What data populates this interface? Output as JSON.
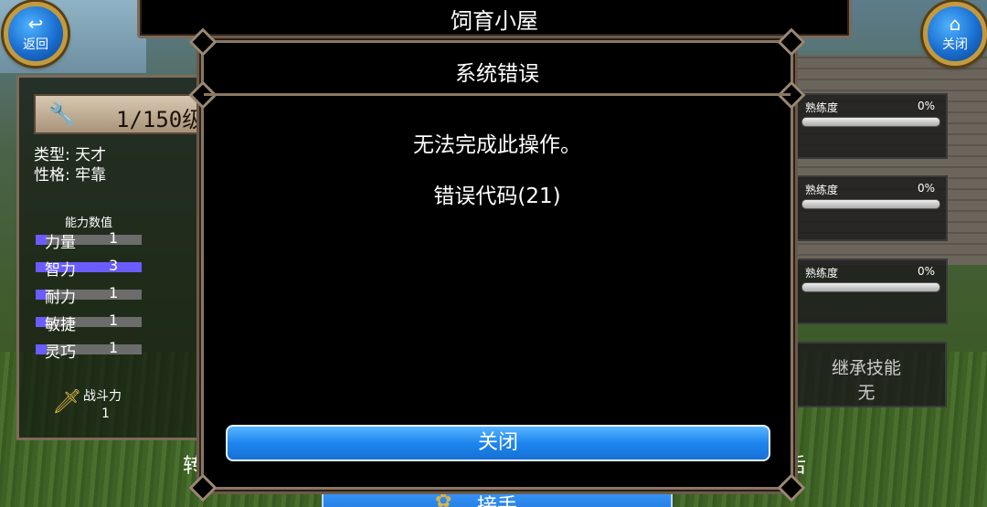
{
  "title_bar": {
    "text": "饲育小屋"
  },
  "buttons": {
    "back": {
      "icon": "back-arrow-icon",
      "label": "返回"
    },
    "close": {
      "icon": "home-icon",
      "label": "关闭"
    }
  },
  "left_panel": {
    "level": "1/150级",
    "type_line": "类型: 天才",
    "personality_line": "性格: 牢靠",
    "stats_title": "能力数值",
    "stats": [
      {
        "name": "力量",
        "value": "1",
        "fill": 0.1
      },
      {
        "name": "智力",
        "value": "3",
        "fill": 1.0
      },
      {
        "name": "耐力",
        "value": "1",
        "fill": 0.1
      },
      {
        "name": "敏捷",
        "value": "1",
        "fill": 0.1
      },
      {
        "name": "灵巧",
        "value": "1",
        "fill": 0.1
      }
    ],
    "combat_label": "战斗力",
    "combat_value": "1"
  },
  "skills": [
    {
      "label": "熟练度",
      "percent": "0%"
    },
    {
      "label": "熟练度",
      "percent": "0%"
    },
    {
      "label": "熟练度",
      "percent": "0%"
    }
  ],
  "inherit": {
    "title": "继承技能",
    "value": "无"
  },
  "bottom": {
    "action_label": "接手",
    "left_char": "转",
    "right_char": "后"
  },
  "modal": {
    "title": "系统错误",
    "message": "无法完成此操作。",
    "code": "错误代码(21)",
    "close_label": "关闭"
  },
  "colors": {
    "accent_blue": "#1d86ee",
    "stat_fill": "#6a5cff",
    "frame": "#8a7764"
  }
}
